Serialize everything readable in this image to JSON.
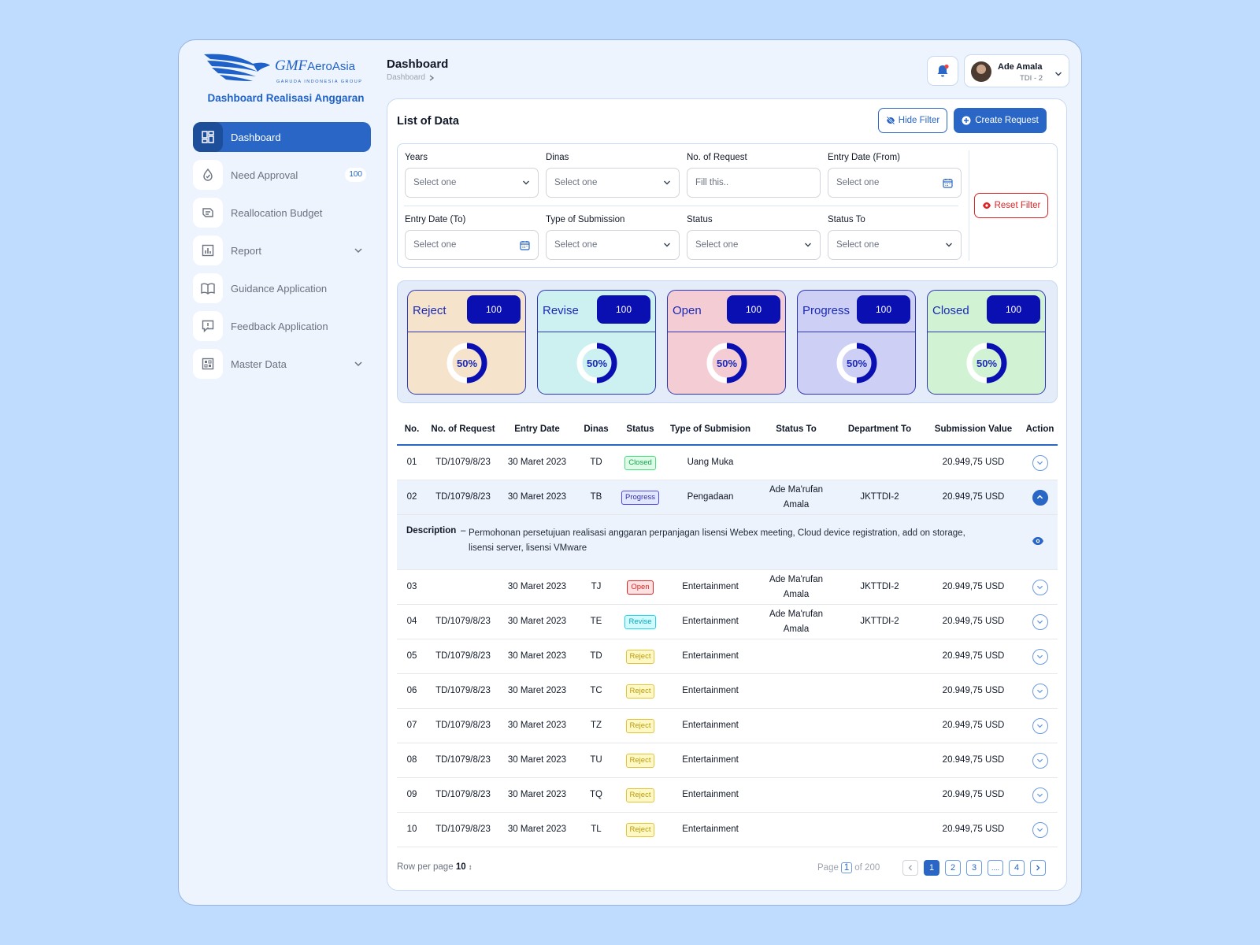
{
  "brand": {
    "name": "GMF",
    "name2": "AeroAsia",
    "group": "GARUDA INDONESIA GROUP",
    "app_title": "Dashboard Realisasi Anggaran"
  },
  "sidebar": {
    "items": [
      {
        "label": "Dashboard",
        "icon": "dashboard-icon",
        "active": true
      },
      {
        "label": "Need Approval",
        "icon": "approval-icon",
        "badge": "100"
      },
      {
        "label": "Reallocation Budget",
        "icon": "reallocation-icon"
      },
      {
        "label": "Report",
        "icon": "report-icon",
        "expandable": true
      },
      {
        "label": "Guidance Application",
        "icon": "book-icon"
      },
      {
        "label": "Feedback Application",
        "icon": "feedback-icon"
      },
      {
        "label": "Master Data",
        "icon": "master-data-icon",
        "expandable": true
      }
    ]
  },
  "header": {
    "title": "Dashboard",
    "breadcrumb": "Dashboard"
  },
  "user": {
    "name": "Ade Amala",
    "role": "TDI - 2"
  },
  "list": {
    "title": "List of Data",
    "hide_filter": "Hide Filter",
    "create_request": "Create Request",
    "reset_filter": "Reset Filter"
  },
  "filters": [
    {
      "label": "Years",
      "value": "Select one",
      "kind": "select"
    },
    {
      "label": "Dinas",
      "value": "Select one",
      "kind": "select"
    },
    {
      "label": "No. of Request",
      "placeholder": "Fill this..",
      "kind": "text"
    },
    {
      "label": "Entry Date (From)",
      "value": "Select one",
      "kind": "date"
    },
    {
      "label": "Entry Date (To)",
      "value": "Select one",
      "kind": "date"
    },
    {
      "label": "Type of Submission",
      "value": "Select one",
      "kind": "select"
    },
    {
      "label": "Status",
      "value": "Select one",
      "kind": "select"
    },
    {
      "label": "Status To",
      "value": "Select one",
      "kind": "select"
    }
  ],
  "stats": [
    {
      "name": "Reject",
      "count": "100",
      "percent_label": "50%",
      "fraction": 0.5,
      "bg": "#f5e3cb"
    },
    {
      "name": "Revise",
      "count": "100",
      "percent_label": "50%",
      "fraction": 0.5,
      "bg": "#cdf1f1"
    },
    {
      "name": "Open",
      "count": "100",
      "percent_label": "50%",
      "fraction": 0.5,
      "bg": "#f4cdd4"
    },
    {
      "name": "Progress",
      "count": "100",
      "percent_label": "50%",
      "fraction": 0.5,
      "bg": "#cdd0f4"
    },
    {
      "name": "Closed",
      "count": "100",
      "percent_label": "50%",
      "fraction": 0.5,
      "bg": "#d2f3d3"
    }
  ],
  "table": {
    "columns": [
      "No.",
      "No. of Request",
      "Entry Date",
      "Dinas",
      "Status",
      "Type of Submision",
      "Status To",
      "Department To",
      "Submission Value",
      "Action"
    ],
    "rows": [
      {
        "no": "01",
        "request": "TD/1079/8/23",
        "date": "30 Maret 2023",
        "dinas": "TD",
        "status": "Closed",
        "type": "Uang Muka",
        "status_to": "",
        "dept": "",
        "value": "20.949,75 USD"
      },
      {
        "no": "02",
        "request": "TD/1079/8/23",
        "date": "30 Maret 2023",
        "dinas": "TB",
        "status": "Progress",
        "type": "Pengadaan",
        "status_to": "Ade Ma'rufan Amala",
        "dept": "JKTTDI-2",
        "value": "20.949,75 USD",
        "expanded": true
      },
      {
        "no": "03",
        "request": "",
        "date": "30 Maret 2023",
        "dinas": "TJ",
        "status": "Open",
        "type": "Entertainment",
        "status_to": "Ade Ma'rufan Amala",
        "dept": "JKTTDI-2",
        "value": "20.949,75 USD"
      },
      {
        "no": "04",
        "request": "TD/1079/8/23",
        "date": "30 Maret 2023",
        "dinas": "TE",
        "status": "Revise",
        "type": "Entertainment",
        "status_to": "Ade Ma'rufan Amala",
        "dept": "JKTTDI-2",
        "value": "20.949,75 USD"
      },
      {
        "no": "05",
        "request": "TD/1079/8/23",
        "date": "30 Maret 2023",
        "dinas": "TD",
        "status": "Reject",
        "type": "Entertainment",
        "status_to": "",
        "dept": "",
        "value": "20.949,75 USD"
      },
      {
        "no": "06",
        "request": "TD/1079/8/23",
        "date": "30 Maret 2023",
        "dinas": "TC",
        "status": "Reject",
        "type": "Entertainment",
        "status_to": "",
        "dept": "",
        "value": "20.949,75 USD"
      },
      {
        "no": "07",
        "request": "TD/1079/8/23",
        "date": "30 Maret 2023",
        "dinas": "TZ",
        "status": "Reject",
        "type": "Entertainment",
        "status_to": "",
        "dept": "",
        "value": "20.949,75 USD"
      },
      {
        "no": "08",
        "request": "TD/1079/8/23",
        "date": "30 Maret 2023",
        "dinas": "TU",
        "status": "Reject",
        "type": "Entertainment",
        "status_to": "",
        "dept": "",
        "value": "20.949,75 USD"
      },
      {
        "no": "09",
        "request": "TD/1079/8/23",
        "date": "30 Maret 2023",
        "dinas": "TQ",
        "status": "Reject",
        "type": "Entertainment",
        "status_to": "",
        "dept": "",
        "value": "20.949,75 USD"
      },
      {
        "no": "10",
        "request": "TD/1079/8/23",
        "date": "30 Maret 2023",
        "dinas": "TL",
        "status": "Reject",
        "type": "Entertainment",
        "status_to": "",
        "dept": "",
        "value": "20.949,75 USD"
      }
    ],
    "description": {
      "label": "Description",
      "dash": "–",
      "text": "Permohonan persetujuan realisasi anggaran perpanjagan lisensi Webex meeting, Cloud device registration, add on storage, lisensi server, lisensi VMware"
    }
  },
  "pagination": {
    "rows_label": "Row per page",
    "rows_value": "10",
    "page_label": "Page",
    "current": "1",
    "of_label": "of 200",
    "pages": [
      "1",
      "2",
      "3",
      "....",
      "4"
    ]
  }
}
